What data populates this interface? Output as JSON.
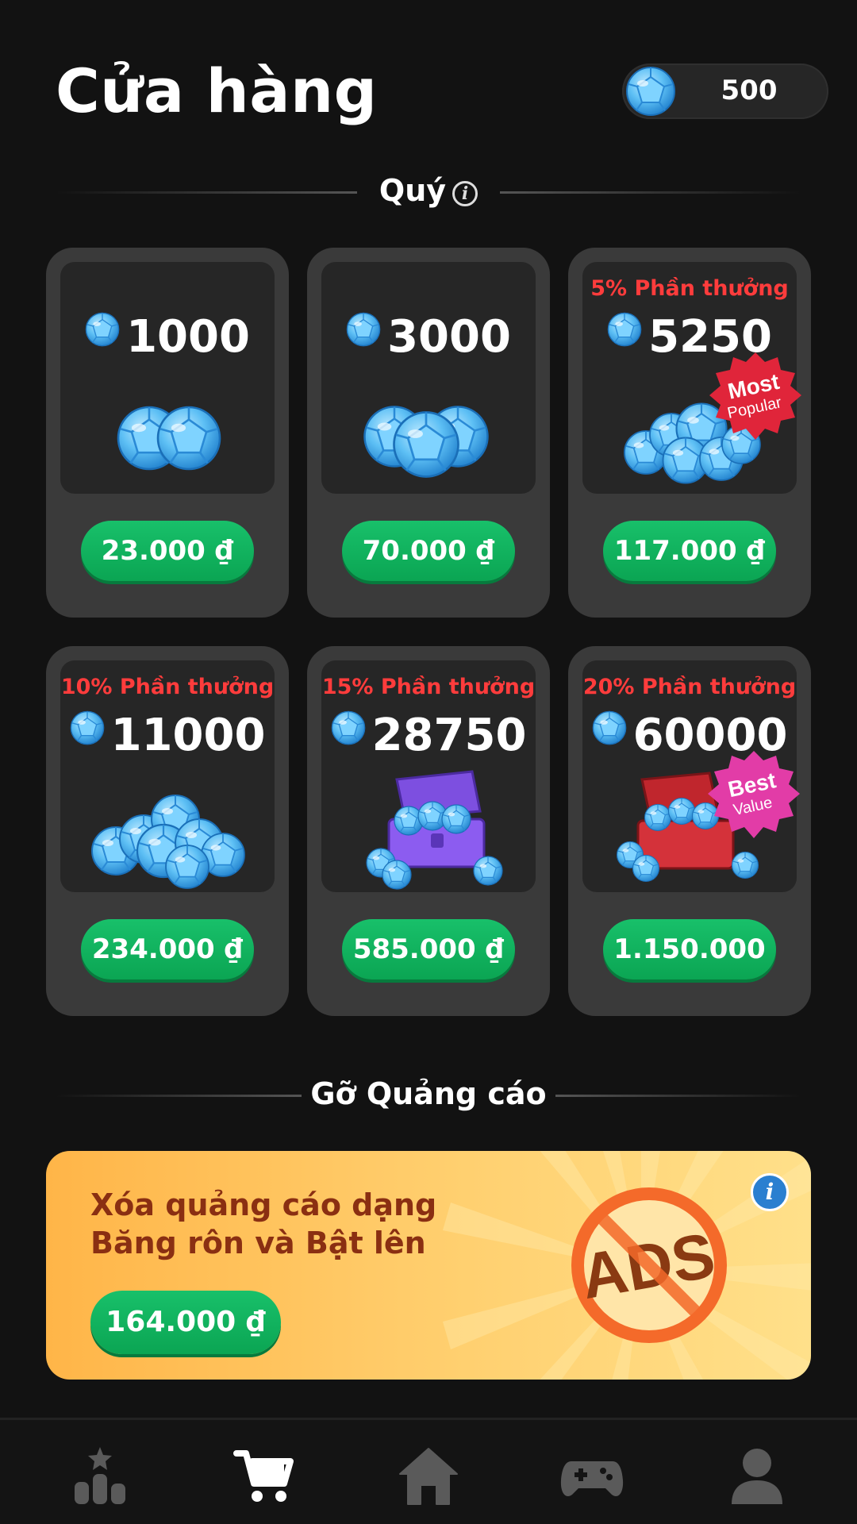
{
  "header": {
    "title": "Cửa hàng",
    "balance": "500"
  },
  "sections": {
    "gems": "Quý",
    "remove_ads": "Gỡ Quảng cáo"
  },
  "packs": [
    {
      "bonus": "",
      "amount": "1000",
      "price": "23.000 ₫",
      "badge": ""
    },
    {
      "bonus": "",
      "amount": "3000",
      "price": "70.000 ₫",
      "badge": ""
    },
    {
      "bonus": "5% Phần thưởng",
      "amount": "5250",
      "price": "117.000 ₫",
      "badge": "Most Popular"
    },
    {
      "bonus": "10% Phần thưởng",
      "amount": "11000",
      "price": "234.000 ₫",
      "badge": ""
    },
    {
      "bonus": "15% Phần thưởng",
      "amount": "28750",
      "price": "585.000 ₫",
      "badge": ""
    },
    {
      "bonus": "20% Phần thưởng",
      "amount": "60000",
      "price": "1.150.000",
      "badge": "Best Value"
    }
  ],
  "badges": {
    "most_popular": {
      "line1": "Most",
      "line2": "Popular"
    },
    "best_value": {
      "line1": "Best",
      "line2": "Value"
    }
  },
  "ads_offer": {
    "line1": "Xóa quảng cáo dạng",
    "line2": "Băng rôn và Bật lên",
    "price": "164.000 ₫",
    "art_text": "ADS"
  },
  "nav": [
    "leaderboard-icon",
    "cart-icon",
    "home-icon",
    "gamepad-icon",
    "profile-icon"
  ],
  "colors": {
    "accent_green": "#0fb35c",
    "bonus_red": "#ff3c3c",
    "gem_blue": "#4fb6f0",
    "background": "#121212"
  }
}
